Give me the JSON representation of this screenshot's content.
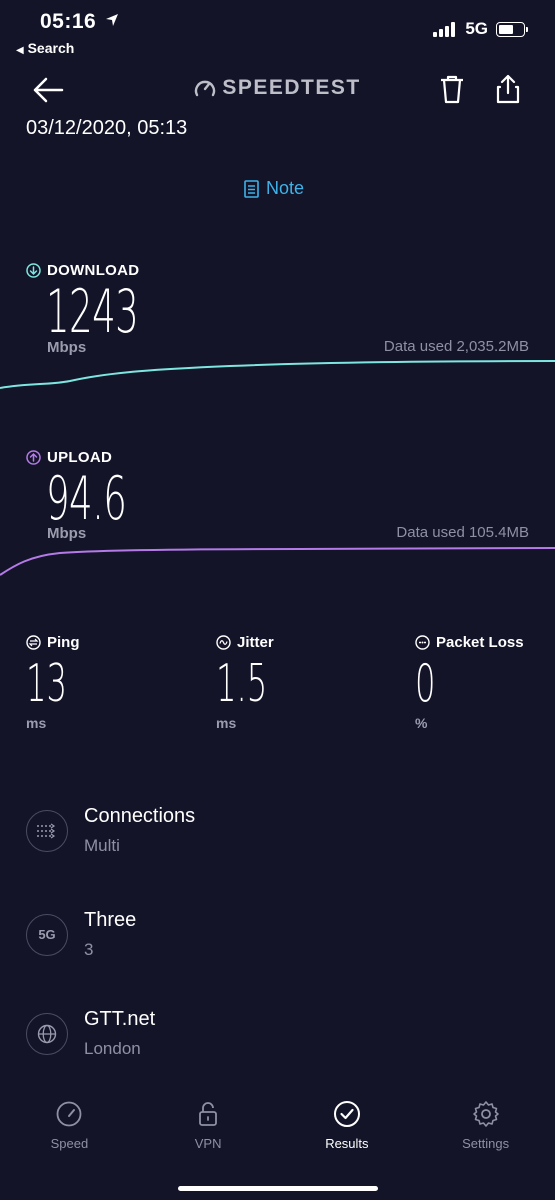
{
  "status": {
    "time": "05:16",
    "back_app": "Search",
    "network": "5G"
  },
  "header": {
    "brand": "SPEEDTEST",
    "datetime": "03/12/2020, 05:13",
    "note_label": "Note"
  },
  "download": {
    "label": "DOWNLOAD",
    "value": "1243",
    "unit": "Mbps",
    "data_used": "Data used 2,035.2MB"
  },
  "upload": {
    "label": "UPLOAD",
    "value": "94.6",
    "unit": "Mbps",
    "data_used": "Data used 105.4MB"
  },
  "metrics": [
    {
      "label": "Ping",
      "value": "13",
      "unit": "ms"
    },
    {
      "label": "Jitter",
      "value": "1.5",
      "unit": "ms"
    },
    {
      "label": "Packet Loss",
      "value": "0",
      "unit": "%"
    }
  ],
  "info": [
    {
      "title": "Connections",
      "subtitle": "Multi",
      "icon": "connections-icon"
    },
    {
      "title": "Three",
      "subtitle": "3",
      "icon": "5g-icon",
      "icon_text": "5G"
    },
    {
      "title": "GTT.net",
      "subtitle": "London",
      "icon": "globe-icon"
    }
  ],
  "tabs": [
    {
      "label": "Speed",
      "icon": "speedometer-icon"
    },
    {
      "label": "VPN",
      "icon": "lock-icon"
    },
    {
      "label": "Results",
      "icon": "check-circle-icon",
      "active": true
    },
    {
      "label": "Settings",
      "icon": "gear-icon"
    }
  ],
  "colors": {
    "background": "#131428",
    "download": "#7ee6e0",
    "upload": "#b47ae8",
    "accent": "#3fb2e9"
  }
}
